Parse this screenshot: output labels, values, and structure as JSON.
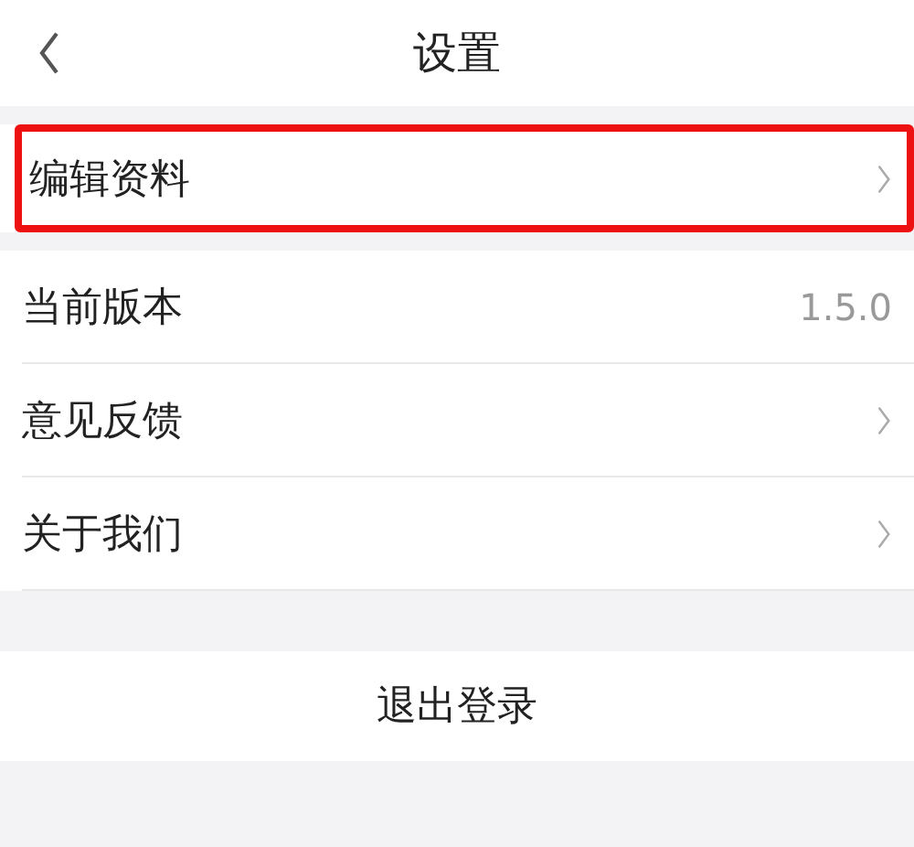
{
  "header": {
    "title": "设置"
  },
  "groups": [
    {
      "items": [
        {
          "kind": "link",
          "label": "编辑资料",
          "highlighted": true
        }
      ]
    },
    {
      "items": [
        {
          "kind": "value",
          "label": "当前版本",
          "value": "1.5.0",
          "highlighted": false
        },
        {
          "kind": "link",
          "label": "意见反馈",
          "highlighted": false
        },
        {
          "kind": "link",
          "label": "关于我们",
          "highlighted": false
        }
      ]
    }
  ],
  "logout_button": {
    "label": "退出登录"
  }
}
